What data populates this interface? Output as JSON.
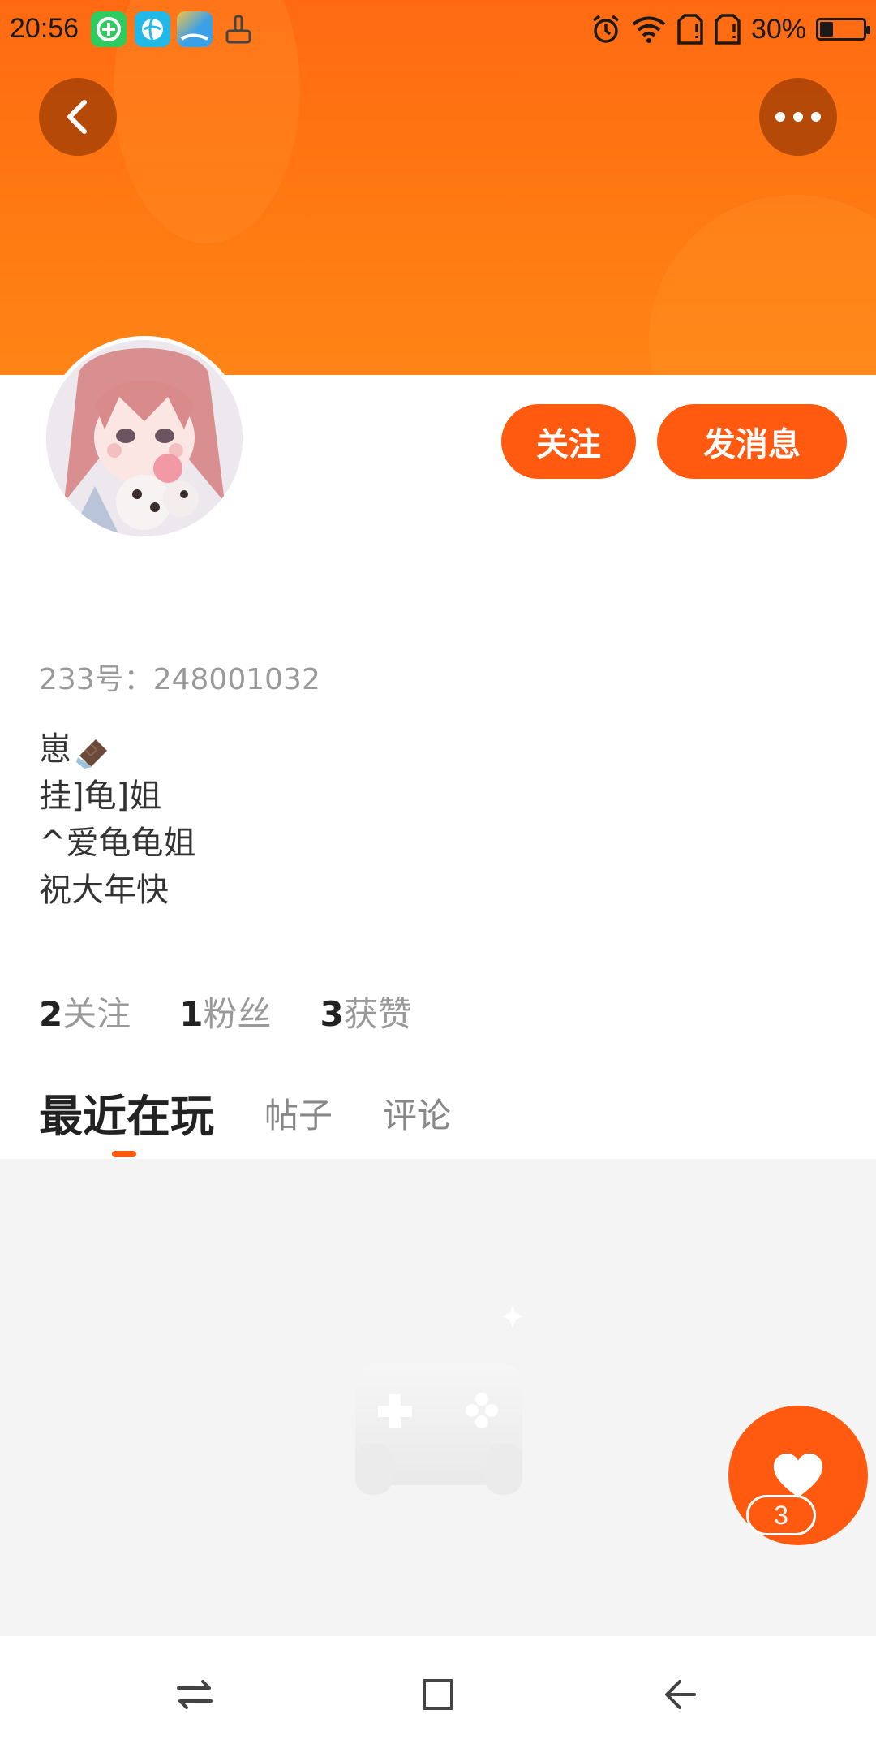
{
  "status_bar": {
    "time": "20:56",
    "battery_percent_text": "30%",
    "battery_level": 0.3,
    "icons": [
      "app-green-icon",
      "app-blue-icon",
      "weather-icon",
      "brush-icon",
      "alarm-icon",
      "wifi-icon",
      "sim1-icon",
      "sim2-icon",
      "battery-icon"
    ]
  },
  "header": {
    "back_icon": "chevron-left-icon",
    "more_icon": "more-dots-icon",
    "banner_color": "#ff6a13"
  },
  "actions": {
    "follow_label": "关注",
    "message_label": "发消息",
    "accent_color": "#ff5a10"
  },
  "profile": {
    "user_id_text": "233号：248001032",
    "bio_lines": [
      "崽",
      "挂]龟]姐",
      "^爱龟龟姐",
      "祝大年快"
    ]
  },
  "stats": {
    "following_count": "2",
    "following_label": "关注",
    "fans_count": "1",
    "fans_label": "粉丝",
    "likes_count": "3",
    "likes_label": "获赞"
  },
  "tabs": [
    {
      "label": "最近在玩",
      "active": true
    },
    {
      "label": "帖子",
      "active": false
    },
    {
      "label": "评论",
      "active": false
    }
  ],
  "like_fab": {
    "icon": "heart-icon",
    "count": "3"
  },
  "nav_bar": {
    "icons": [
      "recent-apps-icon",
      "home-icon",
      "back-icon"
    ]
  }
}
